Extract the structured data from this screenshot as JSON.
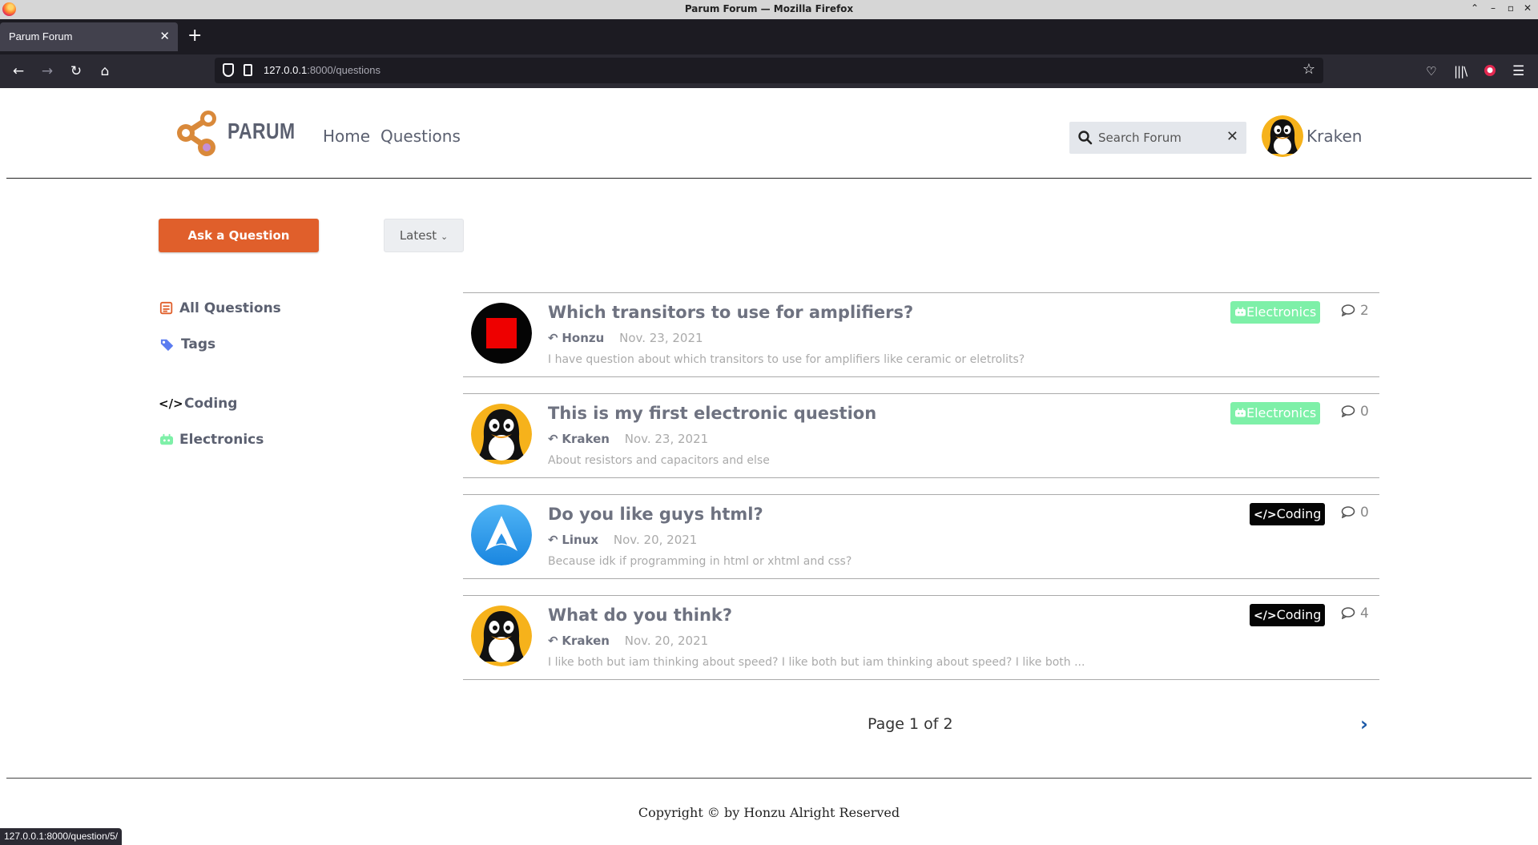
{
  "window": {
    "title": "Parum Forum — Mozilla Firefox"
  },
  "tab": {
    "label": "Parum Forum"
  },
  "address": {
    "host": "127.0.0.1",
    "path": ":8000/questions"
  },
  "status_url": "127.0.0.1:8000/question/5/",
  "header": {
    "brand": "PARUM",
    "nav": {
      "home": "Home",
      "questions": "Questions"
    },
    "search_placeholder": "Search Forum",
    "user_name": "Kraken"
  },
  "toolbar": {
    "ask_label": "Ask a Question",
    "sort_label": "Latest"
  },
  "sidebar": {
    "items": [
      {
        "label": "All Questions",
        "icon": "list-icon"
      },
      {
        "label": "Tags",
        "icon": "tags-icon"
      },
      {
        "label": "Coding",
        "icon": "code-icon"
      },
      {
        "label": "Electronics",
        "icon": "robot-icon"
      }
    ]
  },
  "questions": [
    {
      "title": "Which transitors to use for amplifiers?",
      "author": "Honzu",
      "date": "Nov. 23, 2021",
      "excerpt": "I have question about which transitors to use for amplifiers like ceramic or eletrolits?",
      "tag": "Electronics",
      "comments": "2",
      "avatar": "red-square-avatar"
    },
    {
      "title": "This is my first electronic question",
      "author": "Kraken",
      "date": "Nov. 23, 2021",
      "excerpt": "About resistors and capacitors and else",
      "tag": "Electronics",
      "comments": "0",
      "avatar": "penguin-avatar"
    },
    {
      "title": "Do you like guys html?",
      "author": "Linux",
      "date": "Nov. 20, 2021",
      "excerpt": "Because idk if programming in html or xhtml and css?",
      "tag": "Coding",
      "comments": "0",
      "avatar": "arch-avatar"
    },
    {
      "title": "What do you think?",
      "author": "Kraken",
      "date": "Nov. 20, 2021",
      "excerpt": "I like both but iam thinking about speed? I like both but iam thinking about speed? I like both ...",
      "tag": "Coding",
      "comments": "4",
      "avatar": "penguin-avatar"
    }
  ],
  "pagination": {
    "label": "Page 1 of 2"
  },
  "footer": {
    "text": "Copyright © by Honzu Alright Reserved"
  },
  "colors": {
    "accent": "#e05f2b",
    "electronics_tag": "#7ef0a8",
    "coding_tag": "#050505",
    "text_muted": "#6e7280"
  }
}
